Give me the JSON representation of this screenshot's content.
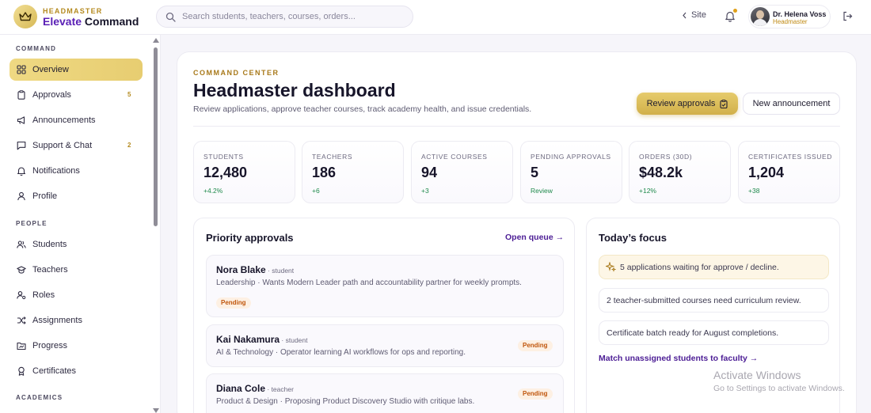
{
  "brand": {
    "eyebrow": "HEADMASTER",
    "name_accent": "Elevate",
    "name_rest": " Command"
  },
  "search": {
    "placeholder": "Search students, teachers, courses, orders..."
  },
  "topbar": {
    "site_label": "Site",
    "user_name": "Dr. Helena Voss",
    "user_role": "Headmaster"
  },
  "sidebar": {
    "sections": {
      "command": "COMMAND",
      "people": "PEOPLE",
      "academics": "ACADEMICS"
    },
    "command_items": [
      {
        "label": "Overview",
        "icon": "grid-icon",
        "active": true
      },
      {
        "label": "Approvals",
        "icon": "clipboard-icon",
        "count": "5"
      },
      {
        "label": "Announcements",
        "icon": "megaphone-icon"
      },
      {
        "label": "Support & Chat",
        "icon": "chat-icon",
        "count": "2"
      },
      {
        "label": "Notifications",
        "icon": "bell-icon"
      },
      {
        "label": "Profile",
        "icon": "user-icon"
      }
    ],
    "people_items": [
      {
        "label": "Students",
        "icon": "users-icon"
      },
      {
        "label": "Teachers",
        "icon": "graduation-cap-icon"
      },
      {
        "label": "Roles",
        "icon": "user-cog-icon"
      },
      {
        "label": "Assignments",
        "icon": "shuffle-icon"
      },
      {
        "label": "Progress",
        "icon": "folder-chart-icon"
      },
      {
        "label": "Certificates",
        "icon": "award-icon"
      }
    ]
  },
  "header": {
    "eyebrow": "COMMAND CENTER",
    "title": "Headmaster dashboard",
    "subtitle": "Review applications, approve teacher courses, track academy health, and issue credentials.",
    "primary_button": "Review approvals",
    "secondary_button": "New announcement"
  },
  "stats": [
    {
      "label": "STUDENTS",
      "value": "12,480",
      "delta": "+4.2%"
    },
    {
      "label": "TEACHERS",
      "value": "186",
      "delta": "+6"
    },
    {
      "label": "ACTIVE COURSES",
      "value": "94",
      "delta": "+3"
    },
    {
      "label": "PENDING APPROVALS",
      "value": "5",
      "delta": "Review"
    },
    {
      "label": "ORDERS (30D)",
      "value": "$48.2k",
      "delta": "+12%"
    },
    {
      "label": "CERTIFICATES ISSUED",
      "value": "1,204",
      "delta": "+38"
    }
  ],
  "priority": {
    "title": "Priority approvals",
    "link": "Open queue →",
    "items": [
      {
        "name": "Nora Blake",
        "role": " · student",
        "desc": "Leadership · Wants Modern Leader path and accountability partner for weekly prompts.",
        "status": "Pending"
      },
      {
        "name": "Kai Nakamura",
        "role": " · student",
        "desc": "AI & Technology · Operator learning AI workflows for ops and reporting.",
        "status": "Pending"
      },
      {
        "name": "Diana Cole",
        "role": " · teacher",
        "desc": "Product & Design · Proposing Product Discovery Studio with critique labs.",
        "status": "Pending"
      }
    ]
  },
  "focus": {
    "title": "Today’s focus",
    "items": [
      "5 applications waiting for approve / decline.",
      "2 teacher-submitted courses need curriculum review.",
      "Certificate batch ready for August completions."
    ],
    "link": "Match unassigned students to faculty →"
  },
  "watermark": {
    "line1": "Activate Windows",
    "line2": "Go to Settings to activate Windows."
  },
  "colors": {
    "accent_gold": "#d7b957",
    "accent_purple": "#4c1d95",
    "positive": "#1f8a4c",
    "pending": "#c0560c"
  }
}
